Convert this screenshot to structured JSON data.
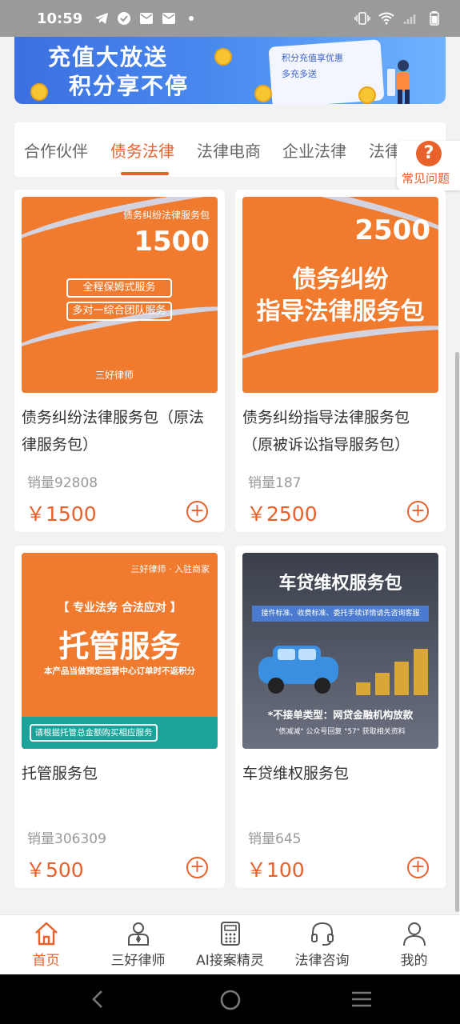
{
  "status_bar": {
    "time": "10:59"
  },
  "banner": {
    "title_line1": "充值大放送",
    "title_line2": "积分享不停",
    "card_line1": "积分充值享优惠",
    "card_line2": "多充多送"
  },
  "tabs": [
    {
      "label": "合作伙伴",
      "active": false
    },
    {
      "label": "债务法律",
      "active": true
    },
    {
      "label": "法律电商",
      "active": false
    },
    {
      "label": "企业法律",
      "active": false
    },
    {
      "label": "法律秘",
      "active": false
    }
  ],
  "faq_label": "常见问题",
  "products": [
    {
      "name": "债务纠纷法律服务包（原法律服务包）",
      "sales": "销量92808",
      "price": "￥1500",
      "image": {
        "top": "债务纠纷法律服务包",
        "number": "1500",
        "pill1": "全程保姆式服务",
        "pill2": "多对一综合团队服务",
        "brand": "三好律师"
      }
    },
    {
      "name": "债务纠纷指导法律服务包（原被诉讼指导服务包）",
      "sales": "销量187",
      "price": "￥2500",
      "image": {
        "number": "2500",
        "line1": "债务纠纷",
        "line2": "指导法律服务包"
      }
    },
    {
      "name": "托管服务包",
      "sales": "销量306309",
      "price": "￥500",
      "image": {
        "brand": "三好律师 · 入驻商家",
        "bracket": "【 专业法务 合法应对 】",
        "big": "托管服务",
        "note": "本产品当做预定运营中心订单时不返积分",
        "foot": "请根据托管总金额购买相应服务"
      }
    },
    {
      "name": "车贷维权服务包",
      "sales": "销量645",
      "price": "￥100",
      "image": {
        "title": "车贷维权服务包",
        "sub": "接件标准、收费标准、委托手续详情请先咨询客服",
        "warn": "*不接单类型：网贷金融机构放款",
        "foot": "\"债减减\" 公众号回复 \"57\" 获取相关资料"
      }
    }
  ],
  "bottom_nav": [
    {
      "label": "首页",
      "icon": "home-icon",
      "active": true
    },
    {
      "label": "三好律师",
      "icon": "lawyer-icon",
      "active": false
    },
    {
      "label": "AI接案精灵",
      "icon": "calculator-icon",
      "active": false
    },
    {
      "label": "法律咨询",
      "icon": "headset-icon",
      "active": false
    },
    {
      "label": "我的",
      "icon": "user-icon",
      "active": false
    }
  ],
  "colors": {
    "accent": "#e8602c",
    "status_bar": "#9a9a9a"
  }
}
